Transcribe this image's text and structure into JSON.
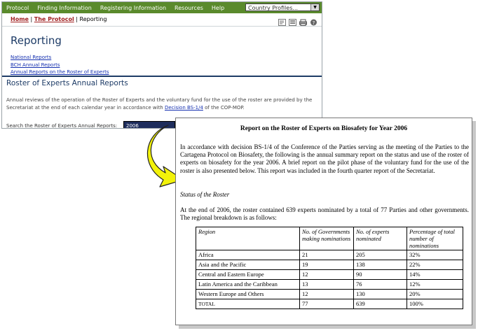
{
  "nav": {
    "items": [
      "Protocol",
      "Finding Information",
      "Registering Information",
      "Resources",
      "Help"
    ],
    "country_select": "Country Profiles..."
  },
  "breadcrumb": {
    "home": "Home",
    "protocol": "The Protocol",
    "current": "Reporting",
    "sep": "|"
  },
  "toolbar_icons": [
    "text-size-icon",
    "text-size-large-icon",
    "print-icon",
    "help-icon"
  ],
  "page": {
    "title": "Reporting",
    "links": [
      "National Reports",
      "BCH Annual Reports",
      "Annual Reports on the Roster of Experts"
    ],
    "section_title": "Roster of Experts Annual Reports",
    "description_pre": "Annual reviews of the operation of the Roster of Experts and the voluntary fund for the use of the roster are provided by the Secretariat at the end of each calendar year in accordance with ",
    "description_link": "Decision BS-1/4",
    "description_post": " of the COP-MOP.",
    "search_label": "Search the Roster of Experts Annual Reports:",
    "search_value": "2006"
  },
  "report": {
    "title": "Report on the Roster of Experts on Biosafety for Year 2006",
    "intro": "In accordance with decision BS-1/4 of the Conference of the Parties serving as the meeting of the Parties to the Cartagena Protocol on Biosafety, the following is the annual summary report on the status and use of the roster of experts on biosafety for the year 2006. A brief report on the pilot phase of the voluntary fund for the use of the roster is also presented below. This report was included in the fourth quarter report of the Secretariat.",
    "status_heading": "Status of the Roster",
    "status_text": "At the end of 2006, the roster contained 639 experts nominated by a total of 77 Parties and other governments.  The regional breakdown is as follows:",
    "table": {
      "headers": [
        "Region",
        "No. of Governments making nominations",
        "No. of experts nominated",
        "Percentage of total number of nominations"
      ],
      "rows": [
        [
          "Africa",
          "21",
          "205",
          "32%"
        ],
        [
          "Asia and the Pacific",
          "19",
          "138",
          "22%"
        ],
        [
          "Central and Eastern Europe",
          "12",
          "90",
          "14%"
        ],
        [
          "Latin America and the Caribbean",
          "13",
          "76",
          "12%"
        ],
        [
          "Western Europe and Others",
          "12",
          "130",
          "20%"
        ],
        [
          "TOTAL",
          "77",
          "639",
          "100%"
        ]
      ]
    }
  },
  "colors": {
    "nav_bg": "#5a8a2c",
    "title_blue": "#1d3b66",
    "link_blue": "#1530b0",
    "breadcrumb_red": "#a01f1f",
    "arrow_yellow": "#f2f20a"
  }
}
